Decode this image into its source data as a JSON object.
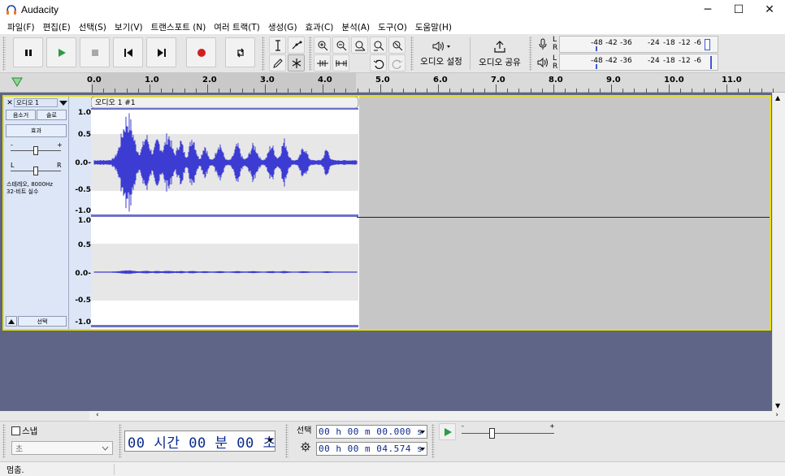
{
  "window": {
    "title": "Audacity",
    "buttons": {
      "minimize": "─",
      "maximize": "☐",
      "close": "✕"
    }
  },
  "menu": [
    "파일(F)",
    "편집(E)",
    "선택(S)",
    "보기(V)",
    "트랜스포트 (N)",
    "여러 트랙(T)",
    "생성(G)",
    "효과(C)",
    "분석(A)",
    "도구(O)",
    "도움말(H)"
  ],
  "toolbar": {
    "audio_setup_label": "오디오 설정",
    "share_audio_label": "오디오 공유",
    "rec_meter": {
      "l": "L",
      "r": "R",
      "scale": [
        "-48",
        "-42",
        "-36",
        "-24",
        "-18",
        "-12",
        "-6"
      ]
    },
    "play_meter": {
      "l": "L",
      "r": "R",
      "scale": [
        "-48",
        "-42",
        "-36",
        "-24",
        "-18",
        "-12",
        "-6"
      ]
    }
  },
  "ruler": {
    "labels": [
      "0.0",
      "1.0",
      "2.0",
      "3.0",
      "4.0",
      "5.0",
      "6.0",
      "7.0",
      "8.0",
      "9.0",
      "10.0",
      "11.0"
    ]
  },
  "track": {
    "name": "오디오 1",
    "clip_name": "오디오 1 #1",
    "mute_label": "음소거",
    "solo_label": "솔로",
    "effects_label": "효과",
    "gain_minus": "-",
    "gain_plus": "+",
    "pan_left": "L",
    "pan_right": "R",
    "info_line1": "스테레오, 8000Hz",
    "info_line2": "32-비트 실수",
    "select_label": "선택",
    "collapse_icon": "triangle-up",
    "scale_top": [
      "1.0",
      "0.5",
      "0.0-",
      "-0.5",
      "-1.0"
    ],
    "scale_bottom": [
      "1.0",
      "0.5",
      "0.0-",
      "-0.5",
      "-1.0"
    ],
    "colors": {
      "wave": "#3c3cd2",
      "selected_border": "#e8e000",
      "background": "#5e6587"
    }
  },
  "bottom": {
    "snap_label": "스냅",
    "snap_unit": "초",
    "time_display": "00 시간 00 분 00 초",
    "selection_label": "선택",
    "sel_start": "00 h 00 m 00.000 s",
    "sel_end": "00 h 00 m 04.574 s",
    "speed_minus": "-",
    "speed_plus": "+"
  },
  "status": {
    "text": "멈춤."
  }
}
